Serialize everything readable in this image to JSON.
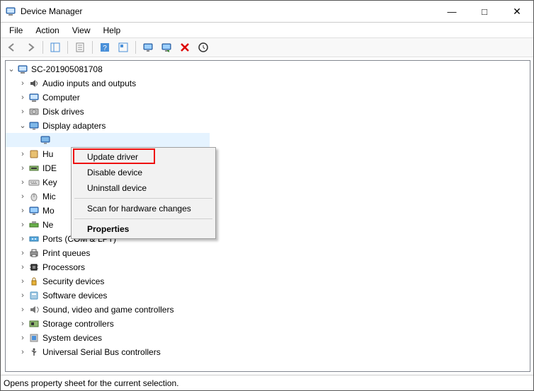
{
  "window": {
    "title": "Device Manager"
  },
  "menubar": {
    "items": [
      "File",
      "Action",
      "View",
      "Help"
    ]
  },
  "tree": {
    "root": {
      "label": "SC-201905081708"
    },
    "display_adapters": {
      "label": "Display adapters"
    },
    "nodes": [
      {
        "label": "Audio inputs and outputs",
        "icon": "audio"
      },
      {
        "label": "Computer",
        "icon": "computer"
      },
      {
        "label": "Disk drives",
        "icon": "disk"
      }
    ],
    "nodes_after": [
      {
        "label": "Hu",
        "icon": "hid"
      },
      {
        "label": "IDE",
        "icon": "ide"
      },
      {
        "label": "Key",
        "icon": "keyboard"
      },
      {
        "label": "Mic",
        "icon": "mouse"
      },
      {
        "label": "Mo",
        "icon": "monitor"
      },
      {
        "label": "Ne",
        "icon": "network"
      },
      {
        "label": "Ports (COM & LPT)",
        "icon": "ports"
      },
      {
        "label": "Print queues",
        "icon": "print"
      },
      {
        "label": "Processors",
        "icon": "cpu"
      },
      {
        "label": "Security devices",
        "icon": "security"
      },
      {
        "label": "Software devices",
        "icon": "software"
      },
      {
        "label": "Sound, video and game controllers",
        "icon": "sound"
      },
      {
        "label": "Storage controllers",
        "icon": "storage"
      },
      {
        "label": "System devices",
        "icon": "system"
      },
      {
        "label": "Universal Serial Bus controllers",
        "icon": "usb"
      }
    ]
  },
  "context_menu": {
    "update": "Update driver",
    "disable": "Disable device",
    "uninstall": "Uninstall device",
    "scan": "Scan for hardware changes",
    "properties": "Properties"
  },
  "statusbar": {
    "text": "Opens property sheet for the current selection."
  }
}
